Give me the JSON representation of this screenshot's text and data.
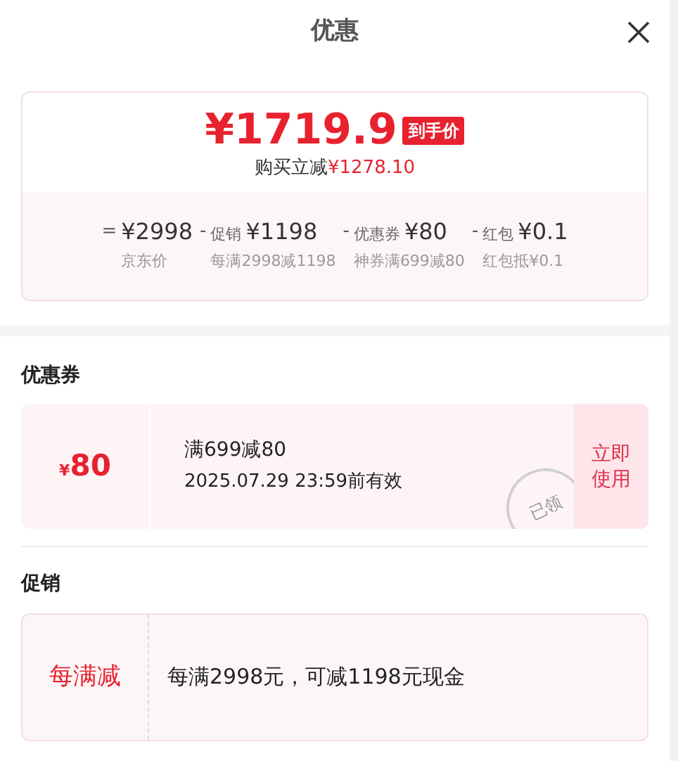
{
  "title": "优惠",
  "summary": {
    "final_price": "¥1719.9",
    "final_badge": "到手价",
    "saving_label": "购买立减",
    "saving_amount": "¥1278.10",
    "breakdown": [
      {
        "operator": "=",
        "amount": "¥2998",
        "note": "京东价"
      },
      {
        "operator": "-",
        "label": "促销",
        "amount": "¥1198",
        "note": "每满2998减1198"
      },
      {
        "operator": "-",
        "label": "优惠券",
        "amount": "¥80",
        "note": "神券满699减80"
      },
      {
        "operator": "-",
        "label": "红包",
        "amount": "¥0.1",
        "note": "红包抵¥0.1"
      }
    ]
  },
  "coupons": {
    "heading": "优惠券",
    "items": [
      {
        "currency": "¥",
        "value": "80",
        "condition": "满699减80",
        "validity": "2025.07.29 23:59前有效",
        "stamp": "已领",
        "action": "立即使用"
      }
    ]
  },
  "promotions": {
    "heading": "促销",
    "items": [
      {
        "tag": "每满减",
        "description": "每满2998元，可减1198元现金"
      }
    ]
  }
}
